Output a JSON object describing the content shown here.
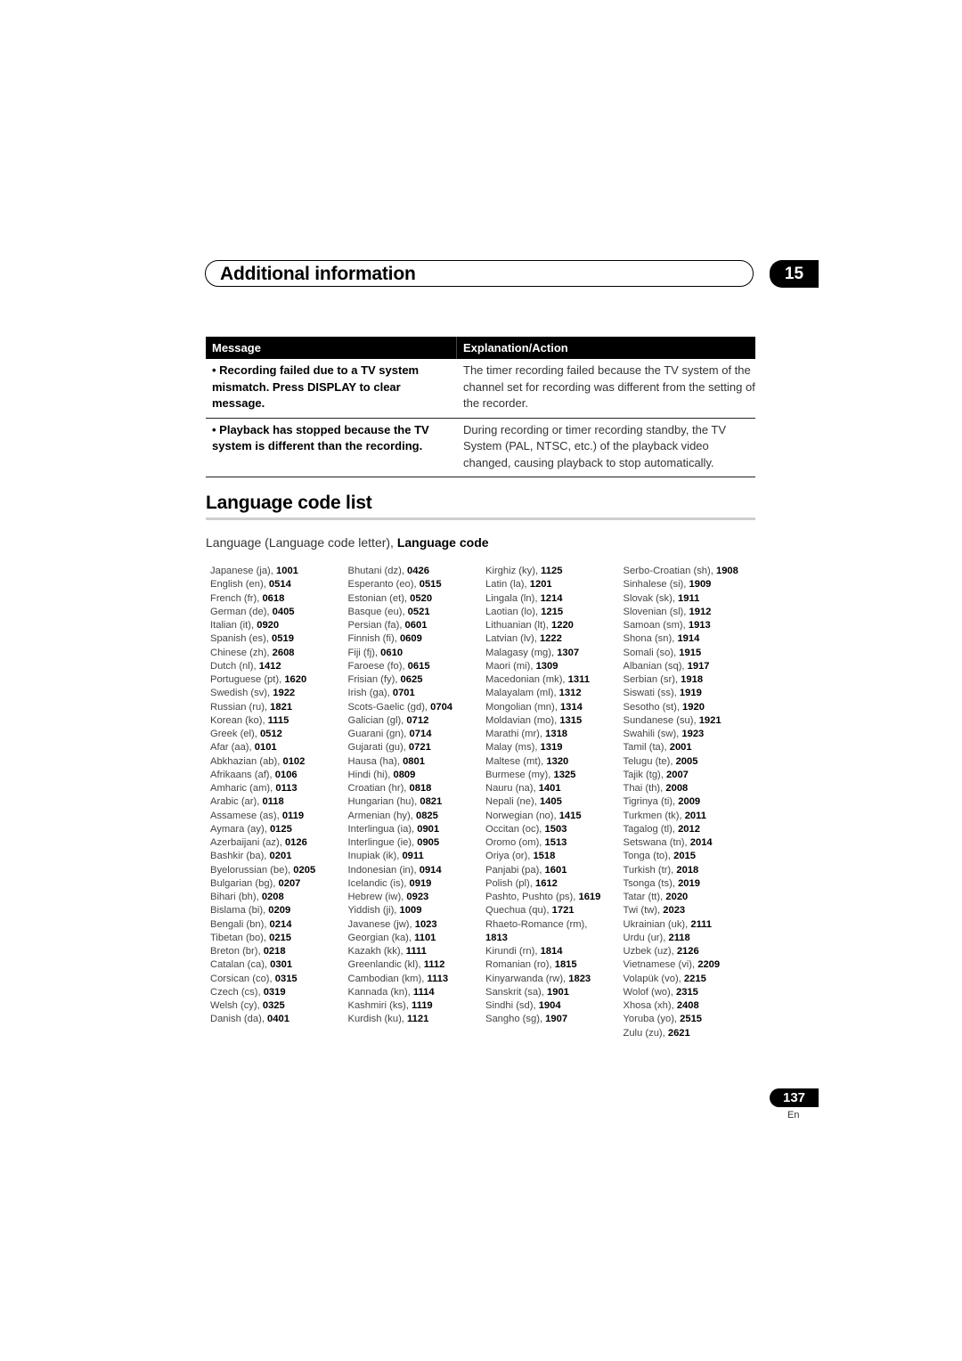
{
  "header": {
    "section_title": "Additional information",
    "chapter_number": "15"
  },
  "message_table": {
    "columns": [
      "Message",
      "Explanation/Action"
    ],
    "rows": [
      {
        "message": "• Recording failed due to a TV system mismatch. Press DISPLAY to clear message.",
        "explanation": "The timer recording failed because the TV system of the channel set for recording was different from the setting of the recorder."
      },
      {
        "message": "• Playback has stopped because the TV system is different than the recording.",
        "explanation": "During recording or timer recording standby, the TV System (PAL, NTSC, etc.) of the playback video changed, causing playback to stop automatically."
      }
    ]
  },
  "language_section": {
    "title": "Language code list",
    "subtitle_prefix": "Language (Language code letter), ",
    "subtitle_bold": "Language code",
    "columns": [
      [
        {
          "name": "Japanese (ja), ",
          "code": "1001"
        },
        {
          "name": "English (en), ",
          "code": "0514"
        },
        {
          "name": "French (fr), ",
          "code": "0618"
        },
        {
          "name": "German (de), ",
          "code": "0405"
        },
        {
          "name": "Italian (it), ",
          "code": "0920"
        },
        {
          "name": "Spanish (es), ",
          "code": "0519"
        },
        {
          "name": "Chinese (zh), ",
          "code": "2608"
        },
        {
          "name": "Dutch (nl), ",
          "code": "1412"
        },
        {
          "name": "Portuguese (pt), ",
          "code": "1620"
        },
        {
          "name": "Swedish (sv), ",
          "code": "1922"
        },
        {
          "name": "Russian (ru), ",
          "code": "1821"
        },
        {
          "name": "Korean (ko), ",
          "code": "1115"
        },
        {
          "name": "Greek (el), ",
          "code": "0512"
        },
        {
          "name": "Afar (aa), ",
          "code": "0101"
        },
        {
          "name": "Abkhazian (ab), ",
          "code": "0102"
        },
        {
          "name": "Afrikaans (af), ",
          "code": "0106"
        },
        {
          "name": "Amharic (am), ",
          "code": "0113"
        },
        {
          "name": "Arabic (ar), ",
          "code": "0118"
        },
        {
          "name": "Assamese (as), ",
          "code": "0119"
        },
        {
          "name": "Aymara (ay), ",
          "code": "0125"
        },
        {
          "name": "Azerbaijani (az), ",
          "code": "0126"
        },
        {
          "name": "Bashkir (ba), ",
          "code": "0201"
        },
        {
          "name": "Byelorussian (be), ",
          "code": "0205"
        },
        {
          "name": "Bulgarian (bg), ",
          "code": "0207"
        },
        {
          "name": "Bihari (bh), ",
          "code": "0208"
        },
        {
          "name": "Bislama (bi), ",
          "code": "0209"
        },
        {
          "name": "Bengali (bn), ",
          "code": "0214"
        },
        {
          "name": "Tibetan (bo), ",
          "code": "0215"
        },
        {
          "name": "Breton (br), ",
          "code": "0218"
        },
        {
          "name": "Catalan (ca), ",
          "code": "0301"
        },
        {
          "name": "Corsican (co), ",
          "code": "0315"
        },
        {
          "name": "Czech (cs), ",
          "code": "0319"
        },
        {
          "name": "Welsh (cy), ",
          "code": "0325"
        },
        {
          "name": "Danish (da), ",
          "code": "0401"
        }
      ],
      [
        {
          "name": "Bhutani (dz), ",
          "code": "0426"
        },
        {
          "name": "Esperanto (eo), ",
          "code": "0515"
        },
        {
          "name": "Estonian (et), ",
          "code": "0520"
        },
        {
          "name": "Basque (eu), ",
          "code": "0521"
        },
        {
          "name": "Persian (fa), ",
          "code": "0601"
        },
        {
          "name": "Finnish (fi), ",
          "code": "0609"
        },
        {
          "name": "Fiji (fj), ",
          "code": "0610"
        },
        {
          "name": "Faroese (fo), ",
          "code": "0615"
        },
        {
          "name": "Frisian (fy), ",
          "code": "0625"
        },
        {
          "name": "Irish (ga), ",
          "code": "0701"
        },
        {
          "name": "Scots-Gaelic (gd), ",
          "code": "0704"
        },
        {
          "name": "Galician (gl), ",
          "code": "0712"
        },
        {
          "name": "Guarani (gn), ",
          "code": "0714"
        },
        {
          "name": "Gujarati (gu), ",
          "code": "0721"
        },
        {
          "name": "Hausa (ha), ",
          "code": "0801"
        },
        {
          "name": "Hindi (hi), ",
          "code": "0809"
        },
        {
          "name": "Croatian (hr), ",
          "code": "0818"
        },
        {
          "name": "Hungarian (hu), ",
          "code": "0821"
        },
        {
          "name": "Armenian (hy), ",
          "code": "0825"
        },
        {
          "name": "Interlingua (ia), ",
          "code": "0901"
        },
        {
          "name": "Interlingue (ie), ",
          "code": "0905"
        },
        {
          "name": "Inupiak (ik), ",
          "code": "0911"
        },
        {
          "name": "Indonesian (in), ",
          "code": "0914"
        },
        {
          "name": "Icelandic (is), ",
          "code": "0919"
        },
        {
          "name": "Hebrew (iw), ",
          "code": "0923"
        },
        {
          "name": "Yiddish (ji), ",
          "code": "1009"
        },
        {
          "name": "Javanese (jw), ",
          "code": "1023"
        },
        {
          "name": "Georgian (ka), ",
          "code": "1101"
        },
        {
          "name": "Kazakh (kk), ",
          "code": "1111"
        },
        {
          "name": "Greenlandic (kl), ",
          "code": "1112"
        },
        {
          "name": "Cambodian (km), ",
          "code": "1113"
        },
        {
          "name": "Kannada (kn), ",
          "code": "1114"
        },
        {
          "name": "Kashmiri (ks), ",
          "code": "1119"
        },
        {
          "name": "Kurdish (ku), ",
          "code": "1121"
        }
      ],
      [
        {
          "name": "Kirghiz (ky), ",
          "code": "1125"
        },
        {
          "name": "Latin (la), ",
          "code": "1201"
        },
        {
          "name": "Lingala (ln), ",
          "code": "1214"
        },
        {
          "name": "Laotian (lo), ",
          "code": "1215"
        },
        {
          "name": "Lithuanian (lt), ",
          "code": "1220"
        },
        {
          "name": "Latvian (lv), ",
          "code": "1222"
        },
        {
          "name": "Malagasy (mg), ",
          "code": "1307"
        },
        {
          "name": "Maori (mi), ",
          "code": "1309"
        },
        {
          "name": "Macedonian (mk), ",
          "code": "1311"
        },
        {
          "name": "Malayalam (ml), ",
          "code": "1312"
        },
        {
          "name": "Mongolian (mn), ",
          "code": "1314"
        },
        {
          "name": "Moldavian (mo), ",
          "code": "1315"
        },
        {
          "name": "Marathi (mr), ",
          "code": "1318"
        },
        {
          "name": "Malay (ms), ",
          "code": "1319"
        },
        {
          "name": "Maltese (mt), ",
          "code": "1320"
        },
        {
          "name": "Burmese (my), ",
          "code": "1325"
        },
        {
          "name": "Nauru (na), ",
          "code": "1401"
        },
        {
          "name": "Nepali (ne), ",
          "code": "1405"
        },
        {
          "name": "Norwegian (no), ",
          "code": "1415"
        },
        {
          "name": "Occitan (oc), ",
          "code": "1503"
        },
        {
          "name": "Oromo (om), ",
          "code": "1513"
        },
        {
          "name": "Oriya (or), ",
          "code": "1518"
        },
        {
          "name": "Panjabi (pa), ",
          "code": "1601"
        },
        {
          "name": "Polish (pl), ",
          "code": "1612"
        },
        {
          "name": "Pashto, Pushto (ps), ",
          "code": "1619"
        },
        {
          "name": "Quechua (qu), ",
          "code": "1721"
        },
        {
          "name": "Rhaeto-Romance (rm), ",
          "code": "1813",
          "wrap": true
        },
        {
          "name": "Kirundi (rn), ",
          "code": "1814"
        },
        {
          "name": "Romanian (ro), ",
          "code": "1815"
        },
        {
          "name": "Kinyarwanda (rw), ",
          "code": "1823"
        },
        {
          "name": "Sanskrit (sa), ",
          "code": "1901"
        },
        {
          "name": "Sindhi (sd), ",
          "code": "1904"
        },
        {
          "name": "Sangho (sg), ",
          "code": "1907"
        }
      ],
      [
        {
          "name": "Serbo-Croatian (sh), ",
          "code": "1908"
        },
        {
          "name": "Sinhalese (si), ",
          "code": "1909"
        },
        {
          "name": "Slovak (sk), ",
          "code": "1911"
        },
        {
          "name": "Slovenian (sl), ",
          "code": "1912"
        },
        {
          "name": "Samoan (sm), ",
          "code": "1913"
        },
        {
          "name": "Shona (sn), ",
          "code": "1914"
        },
        {
          "name": "Somali (so), ",
          "code": "1915"
        },
        {
          "name": "Albanian (sq), ",
          "code": "1917"
        },
        {
          "name": "Serbian (sr), ",
          "code": "1918"
        },
        {
          "name": "Siswati (ss), ",
          "code": "1919"
        },
        {
          "name": "Sesotho (st), ",
          "code": "1920"
        },
        {
          "name": "Sundanese (su), ",
          "code": "1921"
        },
        {
          "name": "Swahili (sw), ",
          "code": "1923"
        },
        {
          "name": "Tamil (ta), ",
          "code": "2001"
        },
        {
          "name": "Telugu (te), ",
          "code": "2005"
        },
        {
          "name": "Tajik (tg), ",
          "code": "2007"
        },
        {
          "name": "Thai (th), ",
          "code": "2008"
        },
        {
          "name": "Tigrinya (ti), ",
          "code": "2009"
        },
        {
          "name": "Turkmen (tk), ",
          "code": "2011"
        },
        {
          "name": "Tagalog (tl), ",
          "code": "2012"
        },
        {
          "name": "Setswana (tn), ",
          "code": "2014"
        },
        {
          "name": "Tonga (to), ",
          "code": "2015"
        },
        {
          "name": "Turkish (tr), ",
          "code": "2018"
        },
        {
          "name": "Tsonga (ts), ",
          "code": "2019"
        },
        {
          "name": "Tatar (tt), ",
          "code": "2020"
        },
        {
          "name": "Twi (tw), ",
          "code": "2023"
        },
        {
          "name": "Ukrainian (uk), ",
          "code": "2111"
        },
        {
          "name": "Urdu (ur), ",
          "code": "2118"
        },
        {
          "name": "Uzbek (uz), ",
          "code": "2126"
        },
        {
          "name": "Vietnamese (vi), ",
          "code": "2209"
        },
        {
          "name": "Volapük (vo), ",
          "code": "2215"
        },
        {
          "name": "Wolof (wo), ",
          "code": "2315"
        },
        {
          "name": "Xhosa (xh), ",
          "code": "2408"
        },
        {
          "name": "Yoruba (yo), ",
          "code": "2515"
        },
        {
          "name": "Zulu (zu), ",
          "code": "2621"
        }
      ]
    ]
  },
  "footer": {
    "page_number": "137",
    "language": "En"
  }
}
